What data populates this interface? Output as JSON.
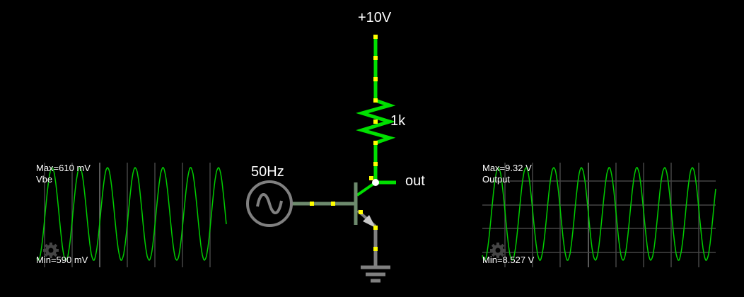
{
  "circuit": {
    "supply_label": "+10V",
    "resistor_label": "1k",
    "source_label": "50Hz",
    "output_label": "out"
  },
  "scopes": [
    {
      "name": "Vbe",
      "max_label": "Max=610 mV",
      "min_label": "Min=590 mV"
    },
    {
      "name": "Output",
      "max_label": "Max=9.32 V",
      "min_label": "Min=8.527 V"
    }
  ],
  "colors": {
    "wire_hot": "#00e000",
    "wire_mid": "#6d8a6d",
    "wire_ground": "#808080",
    "node": "#ffff00",
    "trace": "#00cc00"
  }
}
